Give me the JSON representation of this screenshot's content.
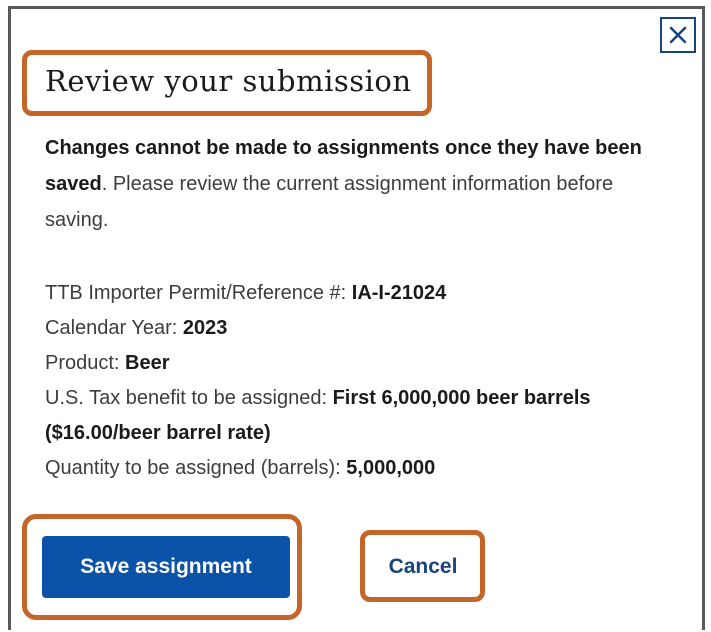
{
  "dialog": {
    "title": "Review your submission",
    "close_icon": "close-x-icon",
    "warning_strong": "Changes cannot be made to assignments once they have been saved",
    "warning_rest": ". Please review the current assignment information before saving."
  },
  "details": [
    {
      "label": "TTB Importer Permit/Reference #: ",
      "value": "IA-I-21024"
    },
    {
      "label": "Calendar Year: ",
      "value": "2023"
    },
    {
      "label": "Product: ",
      "value": "Beer"
    },
    {
      "label": "U.S. Tax benefit to be assigned: ",
      "value": "First 6,000,000 beer barrels ($16.00/beer barrel rate)"
    },
    {
      "label": "Quantity to be assigned (barrels): ",
      "value": "5,000,000"
    }
  ],
  "actions": {
    "save_label": "Save assignment",
    "cancel_label": "Cancel"
  },
  "colors": {
    "highlight": "#c4662a",
    "primary_button": "#0b53a8",
    "link": "#1a4480"
  }
}
